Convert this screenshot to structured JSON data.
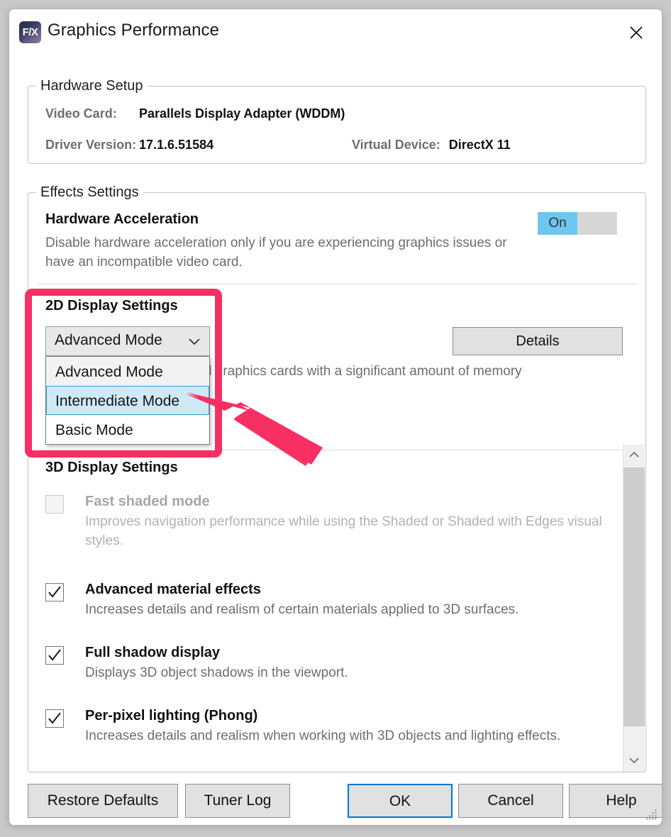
{
  "window": {
    "title": "Graphics Performance",
    "logo_text": "F/X",
    "logo_icon": "fx-app-icon",
    "close_icon": "close-icon"
  },
  "hardware_setup": {
    "legend": "Hardware Setup",
    "video_card_label": "Video Card:",
    "video_card_value": "Parallels Display Adapter (WDDM)",
    "driver_version_label": "Driver Version:",
    "driver_version_value": "17.1.6.51584",
    "virtual_device_label": "Virtual Device:",
    "virtual_device_value": "DirectX 11"
  },
  "effects_settings": {
    "legend": "Effects Settings",
    "hardware_acceleration": {
      "title": "Hardware Acceleration",
      "description": "Disable hardware acceleration only if you are experiencing graphics issues or have an incompatible video card.",
      "toggle_state": "On",
      "toggle_on_color": "#6ec6f0",
      "toggle_track_color": "#d6d6d6"
    },
    "two_d_display": {
      "title": "2D Display Settings",
      "selected_mode": "Advanced Mode",
      "chevron_icon": "chevron-down-icon",
      "options": [
        {
          "label": "Advanced Mode",
          "state": "current"
        },
        {
          "label": "Intermediate Mode",
          "state": "highlighted"
        },
        {
          "label": "Basic Mode",
          "state": "normal"
        }
      ],
      "description": "Recommended for high end graphics cards with a significant amount of memory and processing",
      "details_button": "Details"
    },
    "three_d_display": {
      "title": "3D Display Settings",
      "items": [
        {
          "title": "Fast shaded mode",
          "description": "Improves navigation performance while using the Shaded or Shaded with Edges visual styles.",
          "checked": false,
          "disabled": true
        },
        {
          "title": "Advanced material effects",
          "description": "Increases details and realism of certain materials applied to 3D surfaces.",
          "checked": true,
          "disabled": false
        },
        {
          "title": "Full shadow display",
          "description": "Displays 3D object shadows in the viewport.",
          "checked": true,
          "disabled": false
        },
        {
          "title": "Per-pixel lighting (Phong)",
          "description": "Increases details and realism when working with 3D objects and lighting effects.",
          "checked": true,
          "disabled": false
        }
      ]
    },
    "scrollbar": {
      "up_icon": "chevron-up-icon",
      "down_icon": "chevron-down-icon"
    }
  },
  "footer": {
    "restore_defaults": "Restore Defaults",
    "tuner_log": "Tuner Log",
    "ok": "OK",
    "cancel": "Cancel",
    "help": "Help",
    "focus_color": "#0078d7"
  },
  "annotation": {
    "color": "#f72f63",
    "highlight_target": "2D Display Settings",
    "arrow_points_to": "Intermediate Mode"
  }
}
